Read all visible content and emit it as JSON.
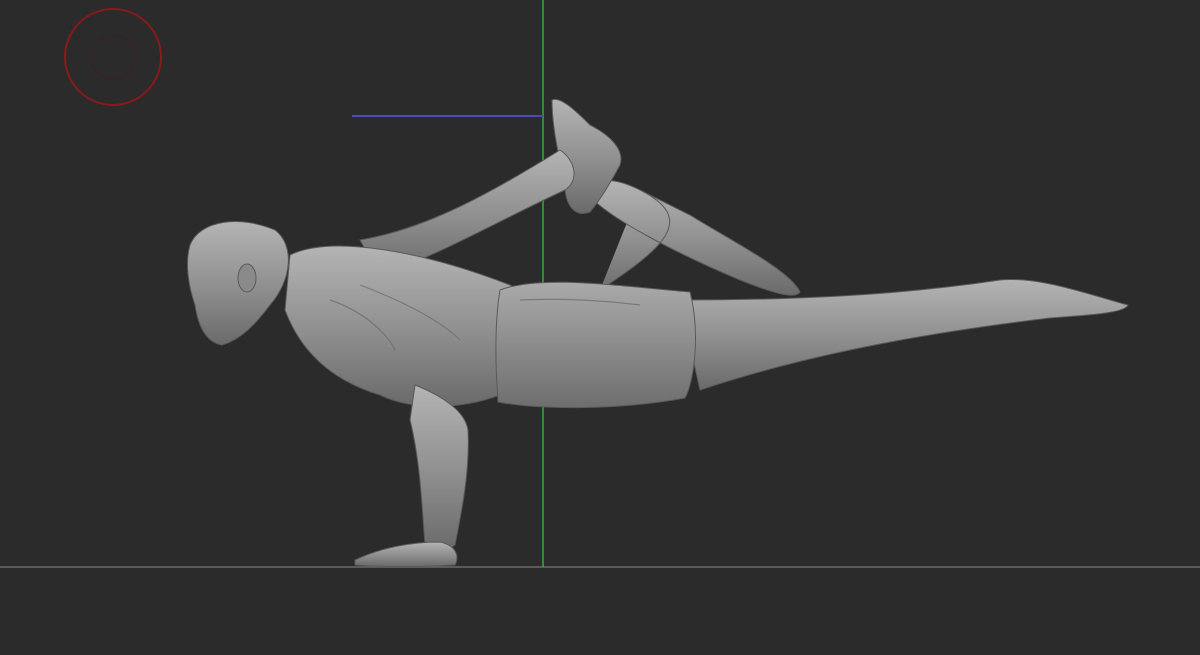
{
  "app": {
    "view_mode": "sculpt-viewport"
  },
  "colors": {
    "background": "#2b2b2b",
    "floor_line": "#6a6a6a",
    "axis_y": "#3fa63f",
    "axis_z": "#4a4ab8",
    "gizmo": "#8a1a1a",
    "model_base": "#8e8e8e"
  },
  "gizmo": {
    "icon": "orientation-gizmo-icon"
  },
  "model": {
    "icon": "sculpted-figure-icon"
  }
}
